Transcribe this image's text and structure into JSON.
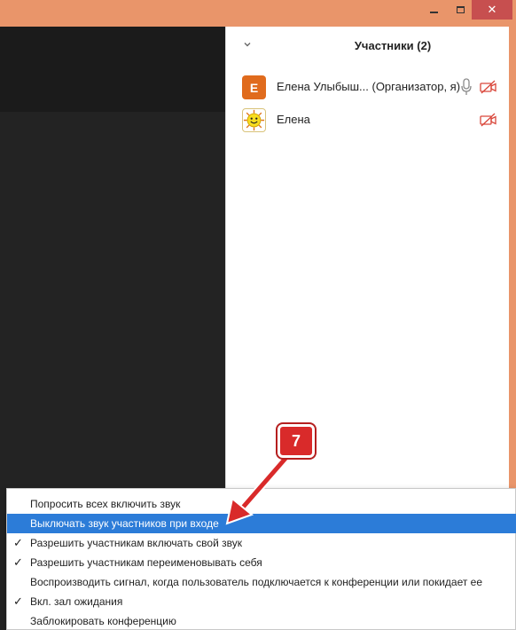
{
  "window": {
    "minimize_label": "minimize",
    "maximize_label": "maximize",
    "close_label": "✕"
  },
  "panel": {
    "title": "Участники (2)",
    "participants": [
      {
        "avatar_letter": "E",
        "name": "Елена Улыбыш... (Организатор, я)",
        "mic": "mic-icon",
        "video": "video-off-icon"
      },
      {
        "avatar_letter": "",
        "name": "Елена",
        "mic": "",
        "video": "video-off-icon"
      }
    ]
  },
  "menu": {
    "items": [
      {
        "label": "Попросить всех включить звук",
        "checked": false,
        "highlighted": false
      },
      {
        "label": "Выключать звук участников при входе",
        "checked": false,
        "highlighted": true
      },
      {
        "label": "Разрешить участникам включать свой звук",
        "checked": true,
        "highlighted": false
      },
      {
        "label": "Разрешить участникам переименовывать себя",
        "checked": true,
        "highlighted": false
      },
      {
        "label": "Воспроизводить сигнал, когда пользователь подключается к конференции или покидает ее",
        "checked": false,
        "highlighted": false
      },
      {
        "label": "Вкл. зал ожидания",
        "checked": true,
        "highlighted": false
      },
      {
        "label": "Заблокировать конференцию",
        "checked": false,
        "highlighted": false
      }
    ],
    "check_glyph": "✓"
  },
  "annotation": {
    "step_number": "7",
    "color": "#d92a2a"
  },
  "colors": {
    "frame": "#e9956a",
    "highlight": "#2c7cd8",
    "video_off": "#d9463a"
  }
}
